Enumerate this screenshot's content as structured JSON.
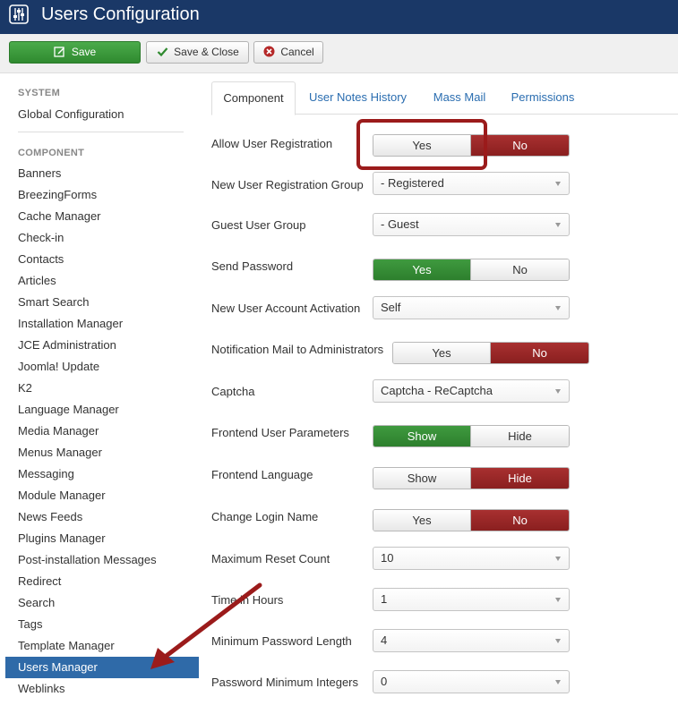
{
  "header": {
    "title": "Users Configuration",
    "icon": "sliders-icon"
  },
  "toolbar": {
    "save": "Save",
    "save_close": "Save & Close",
    "cancel": "Cancel"
  },
  "sidebar": {
    "system_header": "SYSTEM",
    "global_config": "Global Configuration",
    "component_header": "COMPONENT",
    "items": [
      "Banners",
      "BreezingForms",
      "Cache Manager",
      "Check-in",
      "Contacts",
      "Articles",
      "Smart Search",
      "Installation Manager",
      "JCE Administration",
      "Joomla! Update",
      "K2",
      "Language Manager",
      "Media Manager",
      "Menus Manager",
      "Messaging",
      "Module Manager",
      "News Feeds",
      "Plugins Manager",
      "Post-installation Messages",
      "Redirect",
      "Search",
      "Tags",
      "Template Manager",
      "Users Manager",
      "Weblinks"
    ],
    "selected": "Users Manager"
  },
  "tabs": [
    "Component",
    "User Notes History",
    "Mass Mail",
    "Permissions"
  ],
  "form": {
    "allow_reg": {
      "label": "Allow User Registration",
      "on": "Yes",
      "off": "No",
      "selected": "No"
    },
    "new_reg_group": {
      "label": "New User Registration Group",
      "value": "- Registered"
    },
    "guest_group": {
      "label": "Guest User Group",
      "value": "- Guest"
    },
    "send_password": {
      "label": "Send Password",
      "on": "Yes",
      "off": "No",
      "selected": "Yes"
    },
    "activation": {
      "label": "New User Account Activation",
      "value": "Self"
    },
    "notify_admin": {
      "label": "Notification Mail to Administrators",
      "on": "Yes",
      "off": "No",
      "selected": "No"
    },
    "captcha": {
      "label": "Captcha",
      "value": "Captcha - ReCaptcha"
    },
    "frontend_params": {
      "label": "Frontend User Parameters",
      "on": "Show",
      "off": "Hide",
      "selected": "Show"
    },
    "frontend_lang": {
      "label": "Frontend Language",
      "on": "Show",
      "off": "Hide",
      "selected": "Hide"
    },
    "change_login": {
      "label": "Change Login Name",
      "on": "Yes",
      "off": "No",
      "selected": "No"
    },
    "max_reset": {
      "label": "Maximum Reset Count",
      "value": "10"
    },
    "time_hours": {
      "label": "Time in Hours",
      "value": "1"
    },
    "min_pw_len": {
      "label": "Minimum Password Length",
      "value": "4"
    },
    "pw_min_int": {
      "label": "Password Minimum Integers",
      "value": "0"
    }
  },
  "colors": {
    "header": "#1a3867",
    "save_green": "#3a9a3a",
    "toggle_red": "#9b2525",
    "toggle_green": "#2f822f",
    "selection": "#2f6aa8",
    "annotation": "#9b1b1b"
  }
}
